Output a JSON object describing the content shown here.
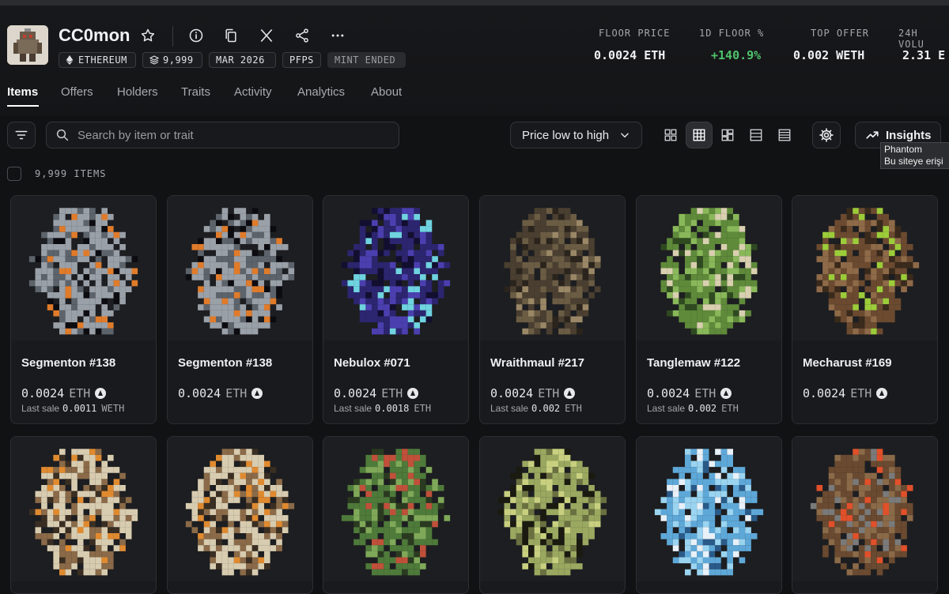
{
  "collection": {
    "name": "CC0mon",
    "badges": [
      "ETHEREUM",
      "9,999",
      "MAR 2026",
      "PFPS",
      "MINT ENDED"
    ]
  },
  "stats": [
    {
      "label": "FLOOR PRICE",
      "value": "0.0024 ETH",
      "positive": false
    },
    {
      "label": "1D FLOOR %",
      "value": "+140.9%",
      "positive": true
    },
    {
      "label": "TOP OFFER",
      "value": "0.002 WETH",
      "positive": false
    },
    {
      "label": "24H VOLU",
      "value": "2.31 E",
      "positive": false
    }
  ],
  "tabs": [
    "Items",
    "Offers",
    "Holders",
    "Traits",
    "Activity",
    "Analytics",
    "About"
  ],
  "toolbar": {
    "search_placeholder": "Search by item or trait",
    "sort_label": "Price low to high",
    "insights_label": "Insights"
  },
  "tooltip": {
    "line1": "Phantom",
    "line2": "Bu siteye erişi"
  },
  "items_count": "9,999 ITEMS",
  "items": [
    {
      "name": "Segmenton #138",
      "price": "0.0024",
      "currency": "ETH",
      "last_sale_label": "Last sale",
      "last_sale_value": "0.0011",
      "last_sale_currency": "WETH",
      "palette": [
        "#9aa0a8",
        "#5d636b",
        "#e07b2a",
        "#0b0b10"
      ]
    },
    {
      "name": "Segmenton #138",
      "price": "0.0024",
      "currency": "ETH",
      "last_sale_label": "",
      "last_sale_value": "",
      "last_sale_currency": "",
      "palette": [
        "#9aa0a8",
        "#5d636b",
        "#e07b2a",
        "#0b0b10"
      ]
    },
    {
      "name": "Nebulox #071",
      "price": "0.0024",
      "currency": "ETH",
      "last_sale_label": "Last sale",
      "last_sale_value": "0.0018",
      "last_sale_currency": "ETH",
      "palette": [
        "#2c2570",
        "#4b3fb0",
        "#6fd3e0",
        "#120e30"
      ]
    },
    {
      "name": "Wraithmaul #217",
      "price": "0.0024",
      "currency": "ETH",
      "last_sale_label": "Last sale",
      "last_sale_value": "0.002",
      "last_sale_currency": "ETH",
      "palette": [
        "#4a3f30",
        "#6b5c44",
        "#2a241c",
        "#9a8766"
      ]
    },
    {
      "name": "Tanglemaw #122",
      "price": "0.0024",
      "currency": "ETH",
      "last_sale_label": "Last sale",
      "last_sale_value": "0.002",
      "last_sale_currency": "ETH",
      "palette": [
        "#5f8a3a",
        "#89b85a",
        "#2f4a20",
        "#d9d0b0"
      ]
    },
    {
      "name": "Mecharust #169",
      "price": "0.0024",
      "currency": "ETH",
      "last_sale_label": "",
      "last_sale_value": "",
      "last_sale_currency": "",
      "palette": [
        "#6b4a30",
        "#8e6a48",
        "#9ccc3a",
        "#3a2a1c"
      ]
    },
    {
      "name": "",
      "price": "",
      "currency": "",
      "last_sale_label": "",
      "last_sale_value": "",
      "last_sale_currency": "",
      "palette": [
        "#d8ccb0",
        "#8a6a48",
        "#e08a30",
        "#3a2e22"
      ]
    },
    {
      "name": "",
      "price": "",
      "currency": "",
      "last_sale_label": "",
      "last_sale_value": "",
      "last_sale_currency": "",
      "palette": [
        "#d8ccb0",
        "#8a6a48",
        "#e08a30",
        "#3a2e22"
      ]
    },
    {
      "name": "",
      "price": "",
      "currency": "",
      "last_sale_label": "",
      "last_sale_value": "",
      "last_sale_currency": "",
      "palette": [
        "#4e7a3a",
        "#7fa858",
        "#c0503a",
        "#2a3a20"
      ]
    },
    {
      "name": "",
      "price": "",
      "currency": "",
      "last_sale_label": "",
      "last_sale_value": "",
      "last_sale_currency": "",
      "palette": [
        "#9aa860",
        "#c8d080",
        "#6a7040",
        "#1a1a10"
      ]
    },
    {
      "name": "",
      "price": "",
      "currency": "",
      "last_sale_label": "",
      "last_sale_value": "",
      "last_sale_currency": "",
      "palette": [
        "#5ea8d8",
        "#9ad4f0",
        "#2a5a88",
        "#e8f0f8"
      ]
    },
    {
      "name": "",
      "price": "",
      "currency": "",
      "last_sale_label": "",
      "last_sale_value": "",
      "last_sale_currency": "",
      "palette": [
        "#6a4a30",
        "#8a6a48",
        "#e0502a",
        "#7a7a7a"
      ]
    }
  ]
}
